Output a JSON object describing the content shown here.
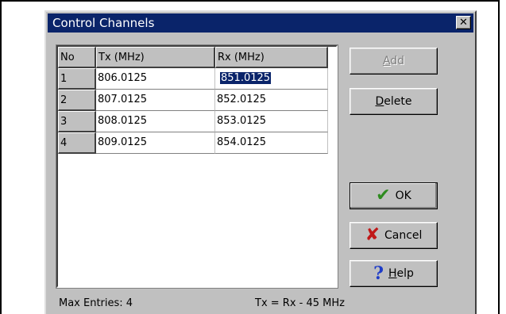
{
  "dialog": {
    "title": "Control Channels",
    "close_glyph": "✕"
  },
  "grid": {
    "headers": {
      "no": "No",
      "tx": "Tx (MHz)",
      "rx": "Rx (MHz)"
    },
    "rows": [
      {
        "no": "1",
        "tx": "806.0125",
        "rx": "851.0125"
      },
      {
        "no": "2",
        "tx": "807.0125",
        "rx": "852.0125"
      },
      {
        "no": "3",
        "tx": "808.0125",
        "rx": "853.0125"
      },
      {
        "no": "4",
        "tx": "809.0125",
        "rx": "854.0125"
      }
    ],
    "selected": {
      "row": 1,
      "column": "rx"
    }
  },
  "buttons": {
    "add": {
      "prefix": "",
      "hotkey": "A",
      "rest": "dd",
      "enabled": false
    },
    "delete": {
      "prefix": "",
      "hotkey": "D",
      "rest": "elete"
    },
    "ok": {
      "label": "OK",
      "icon": "checkmark-icon"
    },
    "cancel": {
      "label": "Cancel",
      "icon": "x-icon"
    },
    "help": {
      "prefix": "",
      "hotkey": "H",
      "rest": "elp",
      "icon": "question-icon"
    }
  },
  "footer": {
    "max_entries": "Max Entries: 4",
    "formula": "Tx = Rx - 45 MHz"
  },
  "colors": {
    "titlebar": "#0a246a",
    "face": "#c0c0c0",
    "selection": "#0a246a"
  }
}
